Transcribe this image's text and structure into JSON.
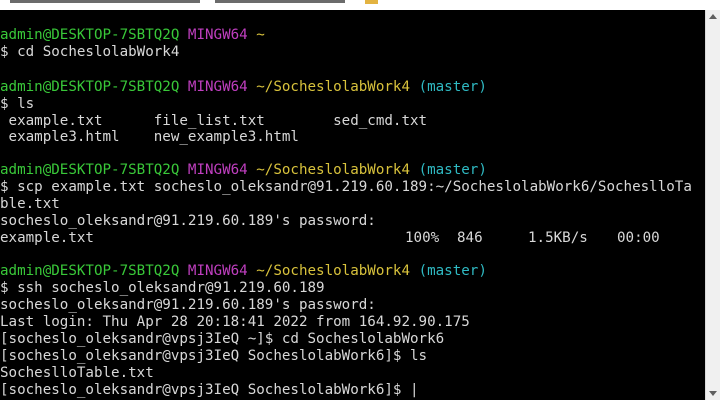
{
  "prompt": {
    "user_host": "admin@DESKTOP-7SBTQ2Q",
    "system": "MINGW64",
    "home": "~",
    "project_path": "~/SocheslolabWork4",
    "branch": "(master)"
  },
  "commands": {
    "cd": "$ cd SocheslolabWork4",
    "ls": "$ ls",
    "scp_part1": "$ scp example.txt socheslo_oleksandr@91.219.60.189:~/SocheslolabWork6/SocheslloTa",
    "scp_part2": "ble.txt",
    "ssh": "$ ssh socheslo_oleksandr@91.219.60.189"
  },
  "ls_output": {
    "row1": " example.txt      file_list.txt        sed_cmd.txt",
    "row2": " example3.html    new_example3.html"
  },
  "scp_output": {
    "password_prompt": "socheslo_oleksandr@91.219.60.189's password:",
    "transfer": {
      "file": "example.txt",
      "percent": "100%",
      "size": "846",
      "rate": "1.5KB/s",
      "time": "00:00"
    }
  },
  "ssh_output": {
    "password_prompt": "socheslo_oleksandr@91.219.60.189's password:",
    "last_login": "Last login: Thu Apr 28 20:18:41 2022 from 164.92.90.175",
    "remote_cd": "[socheslo_oleksandr@vpsj3IeQ ~]$ cd SocheslolabWork6",
    "remote_ls": "[socheslo_oleksandr@vpsj3IeQ SocheslolabWork6]$ ls",
    "remote_ls_output": "SocheslloTable.txt",
    "remote_prompt": "[socheslo_oleksandr@vpsj3IeQ SocheslolabWork6]$ "
  },
  "colors": {
    "background": "#000000",
    "text": "#d8d8d8",
    "user_host": "#39c839",
    "system": "#c03fc0",
    "path": "#d8c23c",
    "branch": "#2fb9c2"
  }
}
